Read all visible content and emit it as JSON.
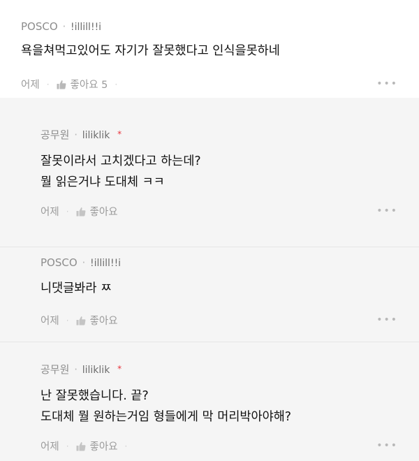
{
  "comments": [
    {
      "author": "POSCO",
      "handle": "!illill!!i",
      "flag": "",
      "lines": [
        "욕을쳐먹고있어도 자기가 잘못했다고 인식을못하네"
      ],
      "time": "어제",
      "like_label": "좋아요 5",
      "more": "•••"
    }
  ],
  "replies": [
    {
      "author": "공무원",
      "handle": "liliklik",
      "flag": "*",
      "lines": [
        "잘못이라서 고치겠다고 하는데?",
        "뭘 읽은거냐 도대체 ㅋㅋ"
      ],
      "time": "어제",
      "like_label": "좋아요",
      "more": "•••"
    },
    {
      "author": "POSCO",
      "handle": "!illill!!i",
      "flag": "",
      "lines": [
        "니댓글봐라 ㅉ"
      ],
      "time": "어제",
      "like_label": "좋아요",
      "more": "•••"
    },
    {
      "author": "공무원",
      "handle": "liliklik",
      "flag": "*",
      "lines": [
        "난 잘못했습니다. 끝?",
        "도대체 뭘 원하는거임 형들에게 막 머리박아야해?"
      ],
      "time": "어제",
      "like_label": "좋아요",
      "more": "•••"
    }
  ],
  "colors": {
    "flag": "#e8333c",
    "reply_bg": "#f5f5f5"
  },
  "icons": {
    "like": "thumbs-up-icon",
    "more": "more-dots-icon"
  }
}
